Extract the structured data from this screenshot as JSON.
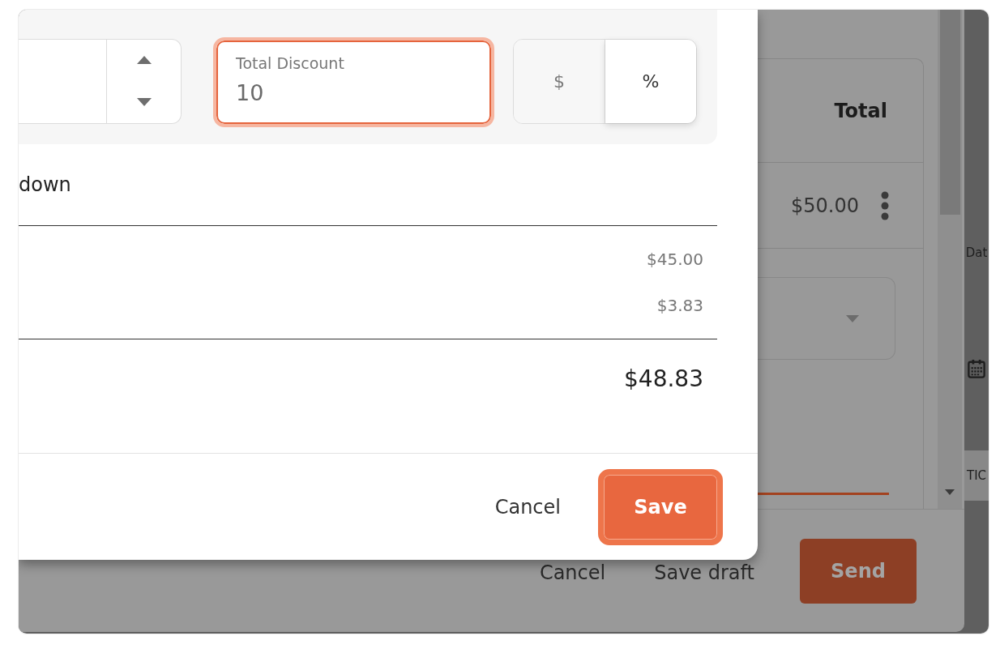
{
  "dialog": {
    "discount_row": {
      "total_discount": {
        "label": "Total Discount",
        "value": "10",
        "focused": true
      },
      "discount_type": [
        {
          "label": "$",
          "selected": false
        },
        {
          "label": "%",
          "selected": true
        }
      ]
    },
    "breakdown": {
      "heading": "down",
      "amounts": [
        "$45.00",
        "$3.83"
      ],
      "total": "$48.83"
    },
    "footer": {
      "buttons": [
        {
          "label": "Cancel",
          "kind": "text",
          "focused": false
        },
        {
          "label": "Save",
          "kind": "primary",
          "focused": true
        }
      ]
    }
  },
  "background": {
    "table": {
      "column_header": "Total",
      "rows": [
        {
          "total": "$50.00"
        }
      ]
    },
    "side_panel": {
      "label": "Dat",
      "band_label": "TIC"
    },
    "footer": {
      "buttons": [
        {
          "label": "Cancel",
          "kind": "text"
        },
        {
          "label": "Save draft",
          "kind": "text"
        },
        {
          "label": "Send",
          "kind": "primary"
        }
      ]
    }
  }
}
